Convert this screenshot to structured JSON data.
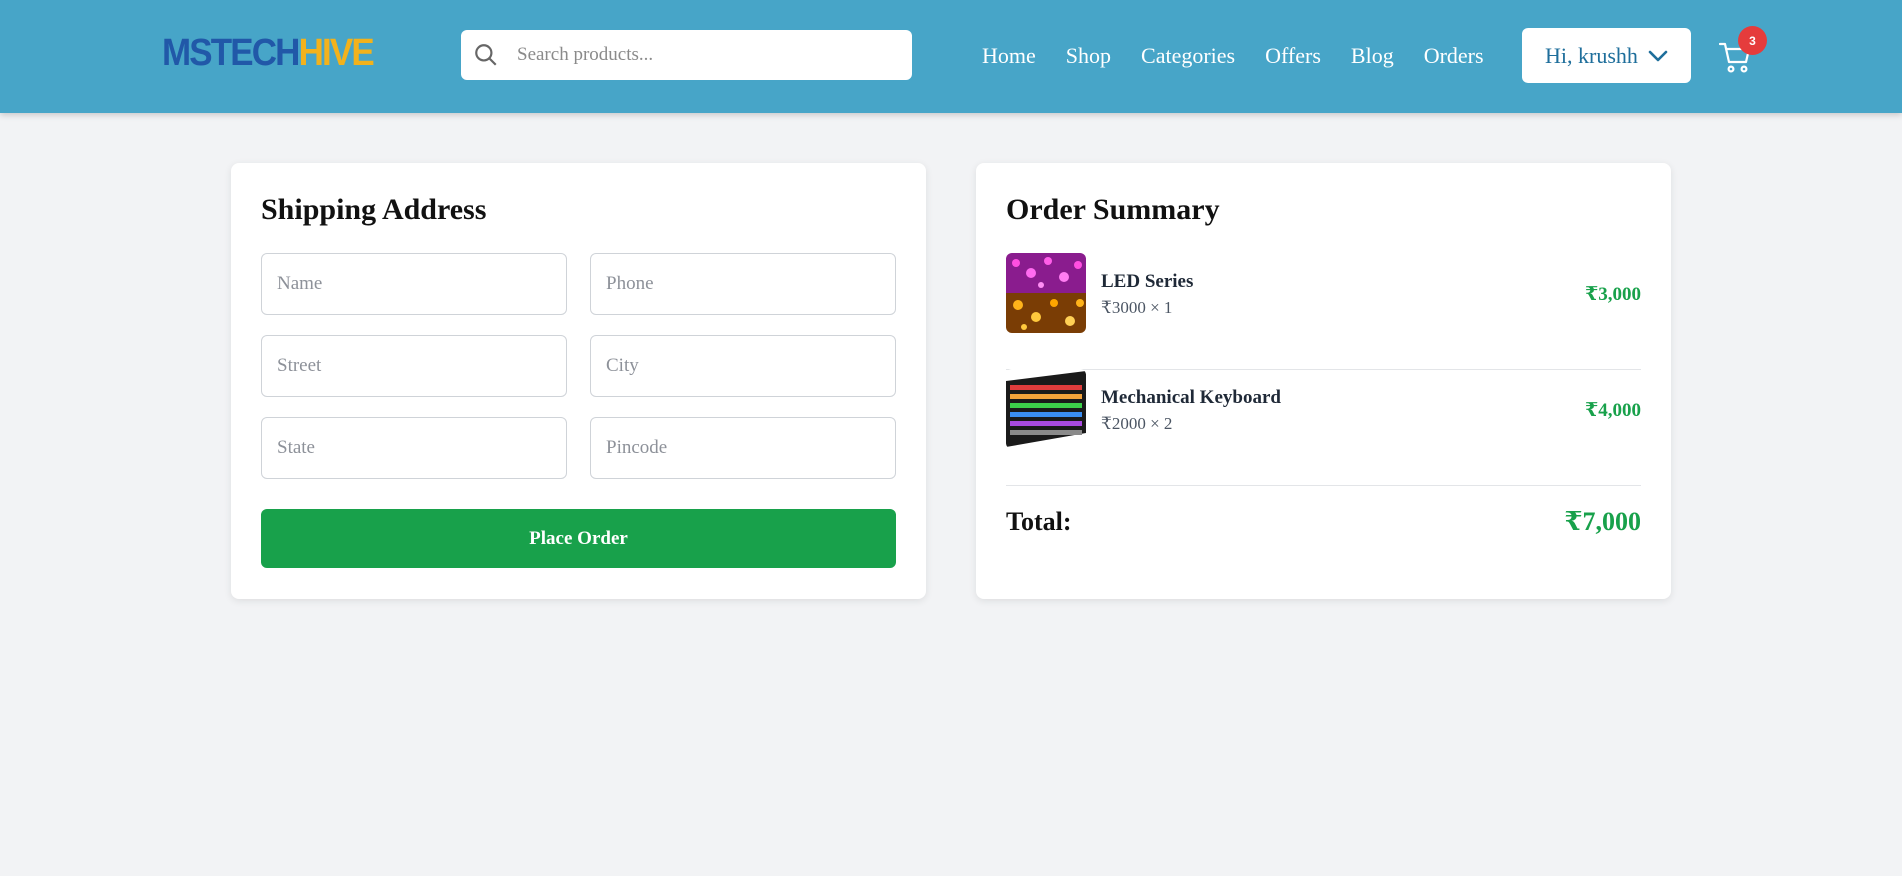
{
  "header": {
    "logo": {
      "part1": "MSTECH",
      "part2": "HIVE"
    },
    "search": {
      "placeholder": "Search products...",
      "icon": "search-icon"
    },
    "nav": [
      "Home",
      "Shop",
      "Categories",
      "Offers",
      "Blog",
      "Orders"
    ],
    "user_label": "Hi, krushh",
    "cart_count": "3"
  },
  "shipping": {
    "title": "Shipping Address",
    "fields": {
      "name": {
        "placeholder": "Name",
        "value": ""
      },
      "phone": {
        "placeholder": "Phone",
        "value": ""
      },
      "street": {
        "placeholder": "Street",
        "value": ""
      },
      "city": {
        "placeholder": "City",
        "value": ""
      },
      "state": {
        "placeholder": "State",
        "value": ""
      },
      "pincode": {
        "placeholder": "Pincode",
        "value": ""
      }
    },
    "submit_label": "Place Order"
  },
  "summary": {
    "title": "Order Summary",
    "items": [
      {
        "name": "LED Series",
        "qty_text": "₹3000 × 1",
        "price": "₹3,000"
      },
      {
        "name": "Mechanical Keyboard",
        "qty_text": "₹2000 × 2",
        "price": "₹4,000"
      }
    ],
    "total_label": "Total:",
    "total_value": "₹7,000"
  },
  "colors": {
    "header_bg": "#47a5c8",
    "logo_primary": "#2158a8",
    "logo_accent": "#f2b21c",
    "accent_green": "#18a14b",
    "badge_red": "#e53c3c"
  }
}
